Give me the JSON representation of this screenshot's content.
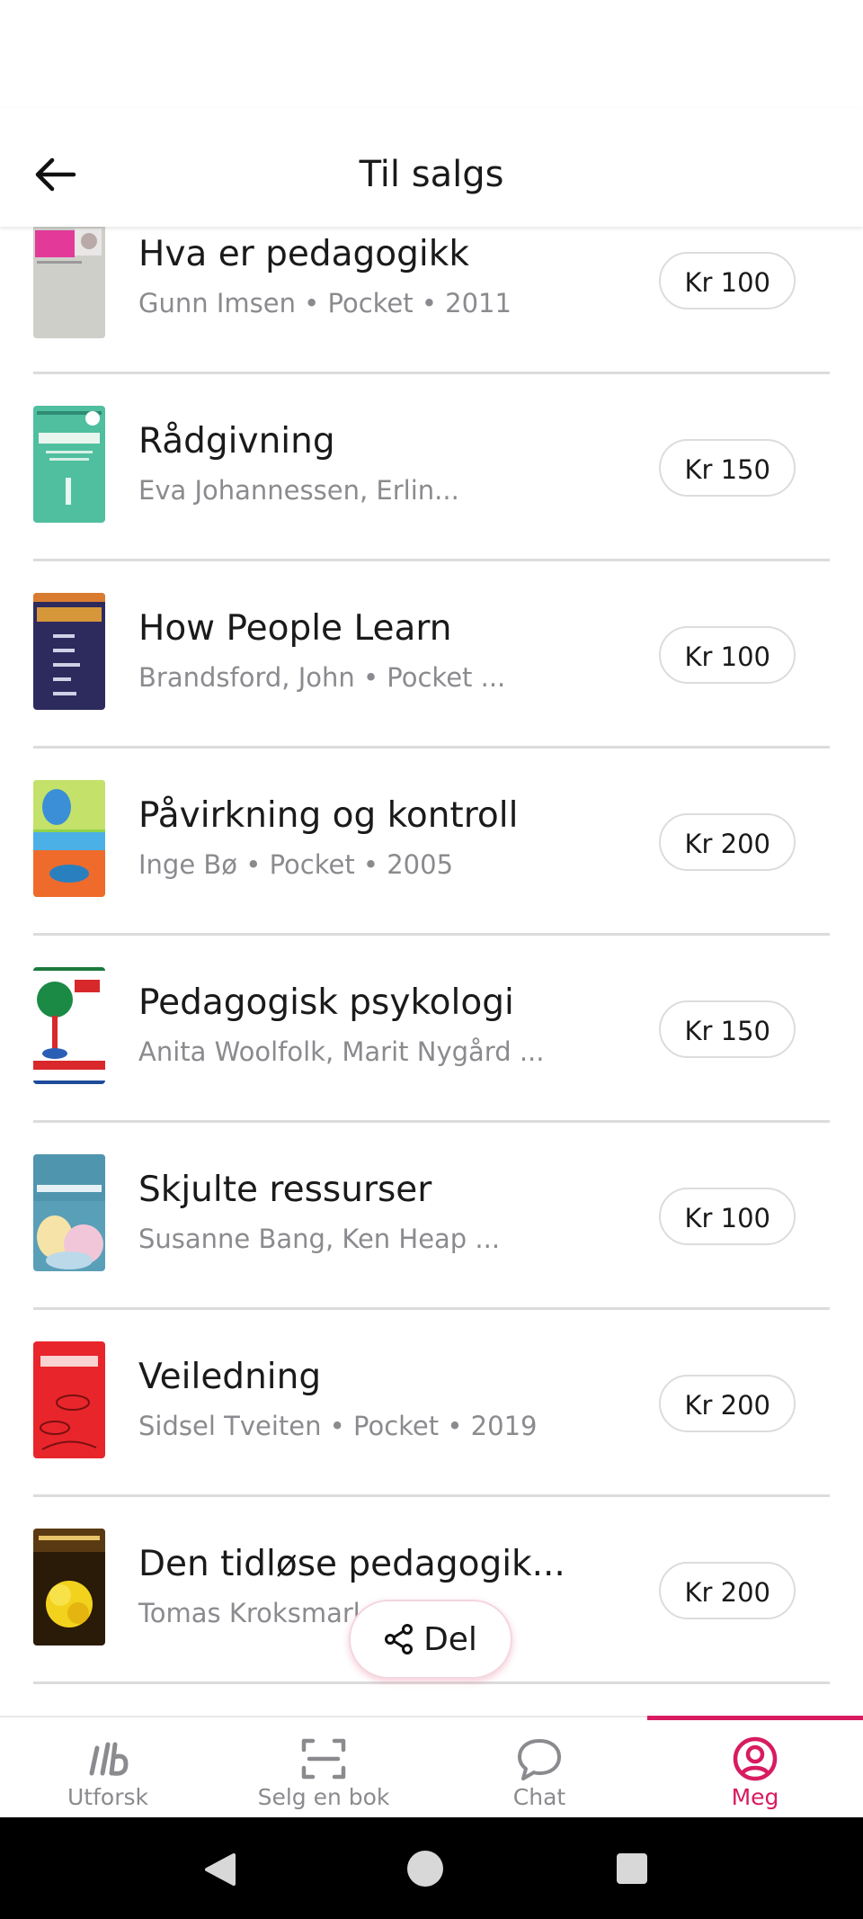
{
  "header": {
    "title": "Til salgs"
  },
  "books": [
    {
      "title": "Hva er pedagogikk",
      "subtitle": "Gunn Imsen • Pocket • 2011",
      "price": "Kr 100"
    },
    {
      "title": "Rådgivning",
      "subtitle": "Eva Johannessen, Erlin...",
      "price": "Kr 150"
    },
    {
      "title": "How People Learn",
      "subtitle": "Brandsford, John • Pocket ...",
      "price": "Kr 100"
    },
    {
      "title": "Påvirkning og kontroll",
      "subtitle": "Inge Bø • Pocket • 2005",
      "price": "Kr 200"
    },
    {
      "title": "Pedagogisk psykologi",
      "subtitle": "Anita Woolfolk, Marit Nygård ...",
      "price": "Kr 150"
    },
    {
      "title": "Skjulte ressurser",
      "subtitle": "Susanne Bang, Ken Heap ...",
      "price": "Kr 100"
    },
    {
      "title": "Veiledning",
      "subtitle": "Sidsel Tveiten • Pocket • 2019",
      "price": "Kr 200"
    },
    {
      "title": "Den tidløse pedagogik...",
      "subtitle": "Tomas Kroksmark, ... bu ...",
      "price": "Kr 200"
    }
  ],
  "share": {
    "label": "Del"
  },
  "nav": {
    "items": [
      {
        "label": "Utforsk",
        "icon": "utforsk-logo-icon"
      },
      {
        "label": "Selg en bok",
        "icon": "scan-icon"
      },
      {
        "label": "Chat",
        "icon": "chat-bubble-icon"
      },
      {
        "label": "Meg",
        "icon": "user-circle-icon"
      }
    ],
    "active_color": "#d81b60"
  }
}
